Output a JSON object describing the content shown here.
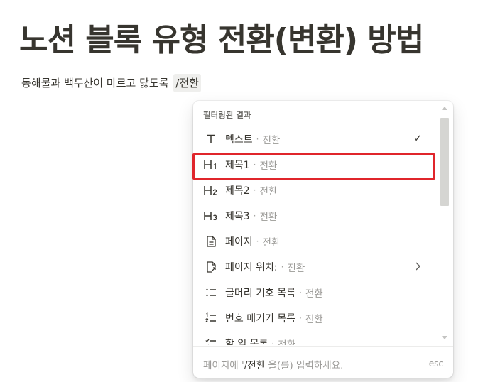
{
  "page": {
    "title": "노션 블록 유형 전환(변환) 방법",
    "block_text": "동해물과 백두산이 마르고 닳도록",
    "slash_command": "/전환"
  },
  "menu": {
    "section_label": "필터링된 결과",
    "separator": "·",
    "items": [
      {
        "icon": "text-icon",
        "label": "텍스트",
        "desc": "전환",
        "trail": "✓"
      },
      {
        "icon": "heading1-icon",
        "label": "제목1",
        "desc": "전환"
      },
      {
        "icon": "heading2-icon",
        "label": "제목2",
        "desc": "전환"
      },
      {
        "icon": "heading3-icon",
        "label": "제목3",
        "desc": "전환"
      },
      {
        "icon": "page-icon",
        "label": "페이지",
        "desc": "전환"
      },
      {
        "icon": "page-location-icon",
        "label": "페이지 위치:",
        "desc": "전환",
        "trail": "chevron-right-icon"
      },
      {
        "icon": "bulleted-list-icon",
        "label": "글머리 기호 목록",
        "desc": "전환"
      },
      {
        "icon": "numbered-list-icon",
        "label": "번호 매기기 목록",
        "desc": "전환"
      },
      {
        "icon": "todo-list-icon",
        "label": "할 일 목록",
        "desc": "전환"
      }
    ],
    "footer": {
      "prefix": "페이지에 '",
      "cmd": "/전환",
      "suffix": " 을(를) 입력하세요.",
      "esc": "esc"
    }
  },
  "colors": {
    "highlight": "#e0252b",
    "text": "#37352f",
    "muted": "#9b9a97"
  }
}
